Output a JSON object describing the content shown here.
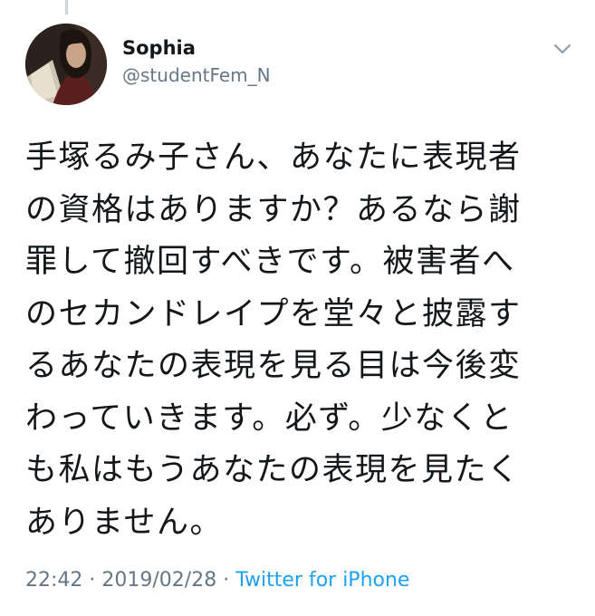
{
  "tweet": {
    "user": {
      "display_name": "Sophia",
      "handle": "@studentFem_N"
    },
    "text": "手塚るみ子さん、あなたに表現者\nの資格はありますか？あるなら謝\n罪して撤回すべきです。被害者へ\nのセカンドレイプを堂々と披露す\nるあなたの表現を見る目は今後変\nわっていきます。必ず。少なくと\nも私はもうあなたの表現を見たく\nありません。",
    "time": "22:42",
    "separator1": "·",
    "date": "2019/02/28",
    "separator2": "·",
    "source": "Twitter for iPhone"
  },
  "colors": {
    "text": "#14171a",
    "secondary": "#657786",
    "link": "#1da1f2",
    "thread_line": "#ccd6dd"
  },
  "icons": {
    "menu": "chevron-down-icon"
  }
}
